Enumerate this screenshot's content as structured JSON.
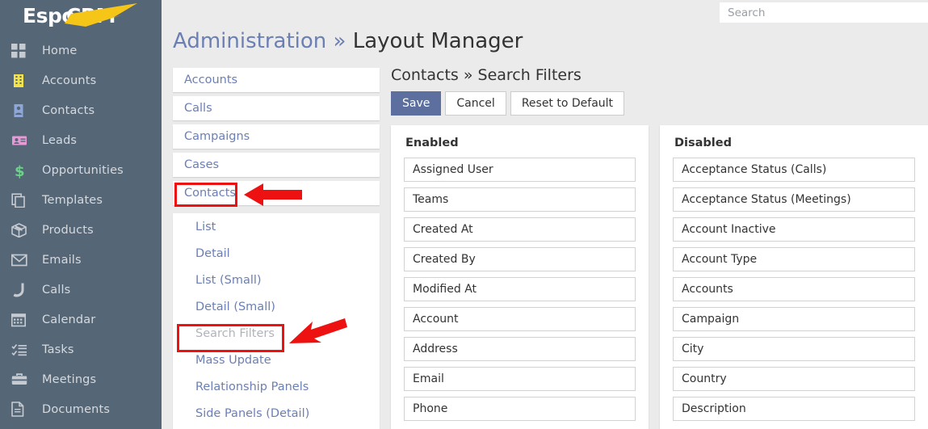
{
  "app": {
    "brand_primary": "Espo",
    "brand_secondary": "CRM",
    "accent_color": "#f5c518",
    "sidebar_color": "#556677",
    "link_color": "#6b7fb3",
    "annotation_color": "#ee1111"
  },
  "search": {
    "placeholder": "Search",
    "value": ""
  },
  "sidebar": {
    "items": [
      {
        "label": "Home",
        "icon": "grid-icon",
        "icon_color": "#c6cbd1"
      },
      {
        "label": "Accounts",
        "icon": "building-icon",
        "icon_color": "#f2e34b"
      },
      {
        "label": "Contacts",
        "icon": "contact-card-icon",
        "icon_color": "#8fa6d8"
      },
      {
        "label": "Leads",
        "icon": "id-badge-icon",
        "icon_color": "#e89ad6"
      },
      {
        "label": "Opportunities",
        "icon": "dollar-icon",
        "icon_color": "#6fd08c"
      },
      {
        "label": "Templates",
        "icon": "copy-icon",
        "icon_color": "#c6cbd1"
      },
      {
        "label": "Products",
        "icon": "box-icon",
        "icon_color": "#c6cbd1"
      },
      {
        "label": "Emails",
        "icon": "envelope-icon",
        "icon_color": "#c6cbd1"
      },
      {
        "label": "Calls",
        "icon": "phone-icon",
        "icon_color": "#c6cbd1"
      },
      {
        "label": "Calendar",
        "icon": "calendar-icon",
        "icon_color": "#c6cbd1"
      },
      {
        "label": "Tasks",
        "icon": "tasks-icon",
        "icon_color": "#c6cbd1"
      },
      {
        "label": "Meetings",
        "icon": "briefcase-icon",
        "icon_color": "#c6cbd1"
      },
      {
        "label": "Documents",
        "icon": "document-icon",
        "icon_color": "#c6cbd1"
      }
    ]
  },
  "page": {
    "breadcrumb_root": "Administration",
    "breadcrumb_separator": "»",
    "breadcrumb_current": "Layout Manager"
  },
  "entity_list": {
    "items": [
      {
        "label": "Accounts"
      },
      {
        "label": "Calls"
      },
      {
        "label": "Campaigns"
      },
      {
        "label": "Cases"
      },
      {
        "label": "Contacts"
      }
    ]
  },
  "layout_list": {
    "items": [
      {
        "label": "List",
        "active": false
      },
      {
        "label": "Detail",
        "active": false
      },
      {
        "label": "List (Small)",
        "active": false
      },
      {
        "label": "Detail (Small)",
        "active": false
      },
      {
        "label": "Search Filters",
        "active": true
      },
      {
        "label": "Mass Update",
        "active": false
      },
      {
        "label": "Relationship Panels",
        "active": false
      },
      {
        "label": "Side Panels (Detail)",
        "active": false
      }
    ]
  },
  "content": {
    "title": "Contacts » Search Filters",
    "buttons": [
      {
        "label": "Save",
        "style": "primary"
      },
      {
        "label": "Cancel",
        "style": "default"
      },
      {
        "label": "Reset to Default",
        "style": "default"
      }
    ],
    "enabled": {
      "title": "Enabled",
      "fields": [
        "Assigned User",
        "Teams",
        "Created At",
        "Created By",
        "Modified At",
        "Account",
        "Address",
        "Email",
        "Phone"
      ]
    },
    "disabled": {
      "title": "Disabled",
      "fields": [
        "Acceptance Status (Calls)",
        "Acceptance Status (Meetings)",
        "Account Inactive",
        "Account Type",
        "Accounts",
        "Campaign",
        "City",
        "Country",
        "Description"
      ]
    }
  },
  "annotations": [
    {
      "name": "contacts-entity-highlight",
      "target": "Contacts"
    },
    {
      "name": "search-filters-highlight",
      "target": "Search Filters"
    }
  ]
}
